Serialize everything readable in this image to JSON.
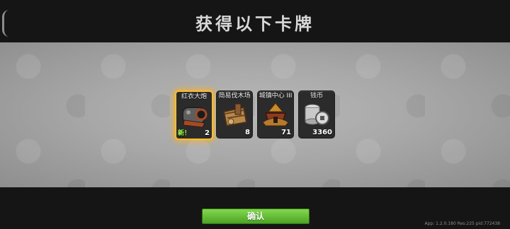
{
  "header": {
    "title": "获得以下卡牌"
  },
  "cards": [
    {
      "name": "红衣大炮",
      "count": "2",
      "badge": "新！",
      "highlight": true,
      "icon": "cannon-icon"
    },
    {
      "name": "简易伐木场",
      "count": "8",
      "highlight": false,
      "icon": "lumber-mill-icon"
    },
    {
      "name": "城镇中心 III",
      "count": "71",
      "highlight": false,
      "icon": "town-center-icon"
    },
    {
      "name": "钱币",
      "count": "3360",
      "highlight": false,
      "icon": "coin-stack-icon"
    }
  ],
  "footer": {
    "confirm_label": "确认",
    "version": "App: 1.2.0.180 Res:225 pid:772438"
  },
  "colors": {
    "highlight": "#ffbd2b",
    "confirm": "#5dbb33"
  }
}
